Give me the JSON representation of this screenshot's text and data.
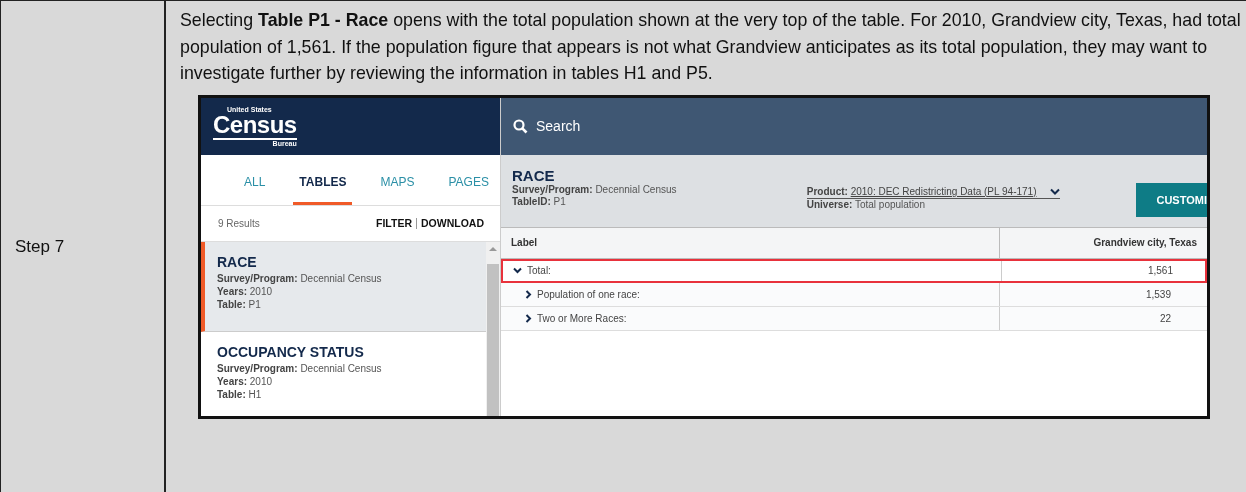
{
  "document": {
    "step_label": "Step 7",
    "paragraph": "Selecting **Table P1 - Race** opens with the total population shown at the very top of the table. For 2010, Grandview city, Texas, had total population of 1,561. If the population figure that appears is not what Grandview anticipates as its total population, they may want to investigate further by reviewing the information in tables H1 and P5."
  },
  "app": {
    "logo": {
      "top": "United States",
      "main": "Census",
      "bottom": "Bureau"
    },
    "search": {
      "placeholder": "Search"
    },
    "tabs": [
      {
        "label": "ALL",
        "selected": false
      },
      {
        "label": "TABLES",
        "selected": true
      },
      {
        "label": "MAPS",
        "selected": false
      },
      {
        "label": "PAGES",
        "selected": false
      }
    ],
    "results_count": "9 Results",
    "actions": [
      "FILTER",
      "DOWNLOAD"
    ],
    "results": [
      {
        "title": "RACE",
        "selected": true,
        "fields": [
          {
            "label": "Survey/Program:",
            "value": "Decennial Census"
          },
          {
            "label": "Years:",
            "value": "2010"
          },
          {
            "label": "Table:",
            "value": "P1"
          }
        ]
      },
      {
        "title": "OCCUPANCY STATUS",
        "selected": false,
        "fields": [
          {
            "label": "Survey/Program:",
            "value": "Decennial Census"
          },
          {
            "label": "Years:",
            "value": "2010"
          },
          {
            "label": "Table:",
            "value": "H1"
          }
        ]
      }
    ],
    "detail": {
      "title": "RACE",
      "meta": [
        {
          "label": "Survey/Program:",
          "value": "Decennial Census"
        },
        {
          "label": "TableID:",
          "value": "P1"
        }
      ],
      "product": {
        "label": "Product:",
        "value": "2010: DEC Redistricting Data (PL 94-171)"
      },
      "universe": {
        "label": "Universe:",
        "value": "Total population"
      },
      "button": "CUSTOMI"
    },
    "table": {
      "columns": [
        "Label",
        "Grandview city, Texas"
      ],
      "rows": [
        {
          "label": "Total:",
          "value": "1,561",
          "expanded": true,
          "highlighted": true,
          "children": [
            {
              "label": "Population of one race:",
              "value": "1,539",
              "expanded": false,
              "highlighted": false
            },
            {
              "label": "Two or More Races:",
              "value": "22",
              "expanded": false,
              "highlighted": false
            }
          ]
        }
      ]
    }
  }
}
